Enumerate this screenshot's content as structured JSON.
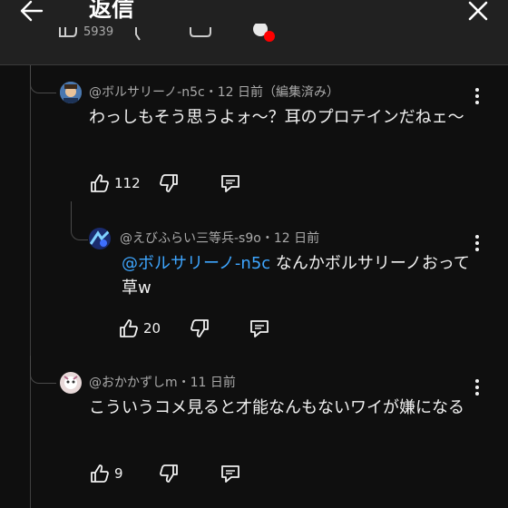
{
  "header": {
    "title": "返信",
    "back_icon": "arrow-left-icon",
    "close_icon": "close-icon",
    "background": "#212121"
  },
  "parent_actions": {
    "like_count_partial": "5939"
  },
  "comments": [
    {
      "author": "@ボルサリーノ-n5c",
      "meta": "・12 日前（編集済み）",
      "text": "わっしもそう思うよォ〜？耳のプロテインだねェ〜",
      "likes": "112"
    },
    {
      "author": "@えびふらい三等兵-s9o",
      "meta": "・12 日前",
      "mention": "@ボルサリーノ-n5c",
      "text": " なんかボルサリーノおって草w",
      "likes": "20"
    },
    {
      "author": "@おかかずしm",
      "meta": "・11 日前",
      "text": "こういうコメ見ると才能なんもないワイが嫌になる",
      "likes": "9"
    }
  ],
  "colors": {
    "background": "#0f0f0f",
    "mention": "#3ea6ff",
    "meta": "#aaaaaa",
    "text": "#f1f1f1"
  }
}
